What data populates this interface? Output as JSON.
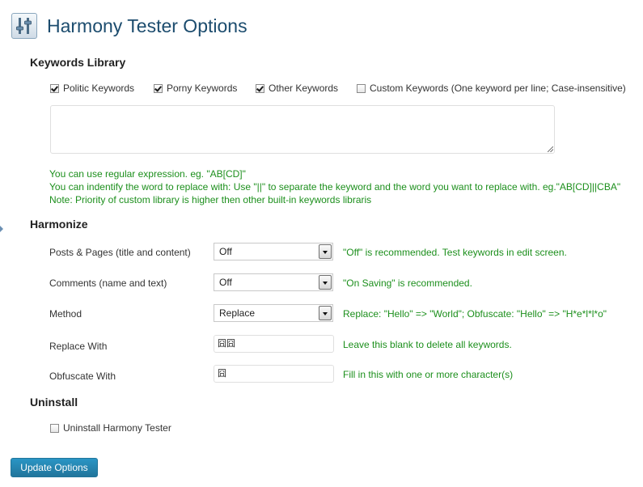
{
  "page": {
    "title": "Harmony Tester Options",
    "icon": "settings-sliders-icon"
  },
  "keywords_library": {
    "heading": "Keywords Library",
    "checkboxes": [
      {
        "label": "Politic Keywords",
        "checked": true
      },
      {
        "label": "Porny Keywords",
        "checked": true
      },
      {
        "label": "Other Keywords",
        "checked": true
      },
      {
        "label": "Custom Keywords (One keyword per line; Case-insensitive)",
        "checked": false
      }
    ],
    "custom_textarea_value": "",
    "notes": [
      "You can use regular expression. eg. \"AB[CD]\"",
      "You can indentify the word to replace with: Use \"||\" to separate the keyword and the word you want to replace with. eg.\"AB[CD]||CBA\"",
      "Note: Priority of custom library is higher then other built-in keywords libraris"
    ]
  },
  "harmonize": {
    "heading": "Harmonize",
    "rows": [
      {
        "label": "Posts & Pages (title and content)",
        "type": "select",
        "value": "Off",
        "hint": "\"Off\" is recommended. Test keywords in edit screen."
      },
      {
        "label": "Comments (name and text)",
        "type": "select",
        "value": "Off",
        "hint": "\"On Saving\" is recommended."
      },
      {
        "label": "Method",
        "type": "select",
        "value": "Replace",
        "hint": "Replace: \"Hello\" => \"World\"; Obfuscate: \"Hello\" => \"H*e*l*l*o\""
      },
      {
        "label": "Replace With",
        "type": "text",
        "value": "囧囧",
        "hint": "Leave this blank to delete all keywords."
      },
      {
        "label": "Obfuscate With",
        "type": "text",
        "value": "囧",
        "hint": "Fill in this with one or more character(s)"
      }
    ]
  },
  "uninstall": {
    "heading": "Uninstall",
    "checkbox": {
      "label": "Uninstall Harmony Tester",
      "checked": false
    }
  },
  "footer": {
    "update_button": "Update Options"
  },
  "colors": {
    "title": "#1c4c6e",
    "hint_green": "#1c8f1c",
    "button_blue": "#21759b"
  }
}
